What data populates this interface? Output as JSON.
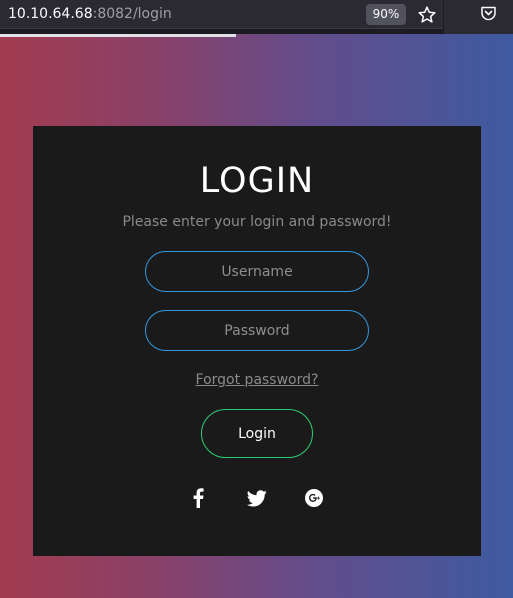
{
  "browser": {
    "url_host": "10.10.64.68",
    "url_rest": ":8082/login",
    "zoom": "90%",
    "icons": [
      "star-icon",
      "pocket-icon"
    ],
    "load_progress": 0.46
  },
  "login": {
    "title": "LOGIN",
    "subtitle": "Please enter your login and password!",
    "username_placeholder": "Username",
    "password_placeholder": "Password",
    "forgot_label": "Forgot password?",
    "submit_label": "Login",
    "social_icons": [
      "facebook-icon",
      "twitter-icon",
      "google-plus-icon"
    ]
  },
  "colors": {
    "field_border": "#3498db",
    "button_border": "#2ecc71",
    "card_bg": "#1a1a1a",
    "gradient_left": "#a23b4f",
    "gradient_right": "#3e5aa0"
  }
}
